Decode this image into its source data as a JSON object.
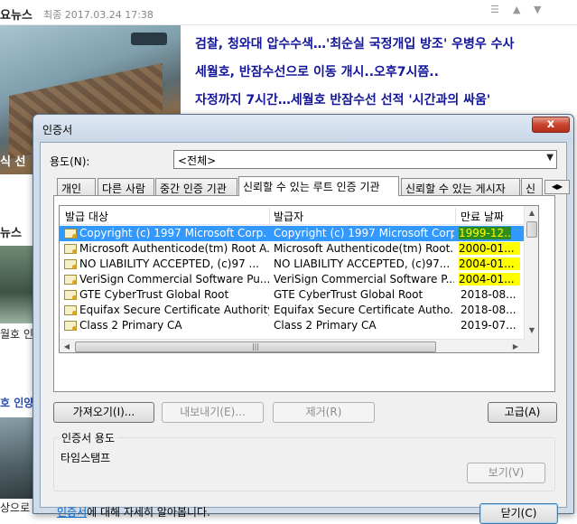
{
  "news": {
    "source": "요뉴스",
    "date": "최종 2017.03.24 17:38",
    "headlines": [
      "검찰, 청와대 압수수색…'최순실 국정개입 방조' 우병우 수사",
      "세월호, 반잠수선으로 이동 개시..오후7시쯤..",
      "자정까지 7시간…세월호 반잠수선 선적 '시간과의 싸움'"
    ],
    "left_snippets": [
      "식 선",
      "뉴스",
      "월호 인",
      "호 인양",
      "상으로"
    ]
  },
  "dialog": {
    "title": "인증서",
    "close_label": "x",
    "purpose_label": "용도(N):",
    "purpose_value": "<전체>",
    "tabs": [
      "개인",
      "다른 사람",
      "중간 인증 기관",
      "신뢰할 수 있는 루트 인증 기관",
      "신뢰할 수 있는 게시자",
      "신"
    ],
    "active_tab": "신뢰할 수 있는 루트 인증 기관",
    "columns": [
      "발급 대상",
      "발급자",
      "만료 날짜"
    ],
    "rows": [
      {
        "issued_to": "Copyright (c) 1997 Microsoft Corp.",
        "issued_by": "Copyright (c) 1997 Microsoft Corp.",
        "expiry": "1999-12...",
        "selected": true,
        "highlight": "green"
      },
      {
        "issued_to": "Microsoft Authenticode(tm) Root A...",
        "issued_by": "Microsoft Authenticode(tm) Root...",
        "expiry": "2000-01...",
        "selected": false,
        "highlight": "yellow"
      },
      {
        "issued_to": "NO LIABILITY ACCEPTED, (c)97 ...",
        "issued_by": "NO LIABILITY ACCEPTED, (c)97...",
        "expiry": "2004-01...",
        "selected": false,
        "highlight": "yellow"
      },
      {
        "issued_to": "VeriSign Commercial Software Pu...",
        "issued_by": "VeriSign Commercial Software P...",
        "expiry": "2004-01...",
        "selected": false,
        "highlight": "yellow"
      },
      {
        "issued_to": "GTE CyberTrust Global Root",
        "issued_by": "GTE CyberTrust Global Root",
        "expiry": "2018-08...",
        "selected": false,
        "highlight": ""
      },
      {
        "issued_to": "Equifax Secure Certificate Authority",
        "issued_by": "Equifax Secure Certificate Autho...",
        "expiry": "2018-08...",
        "selected": false,
        "highlight": ""
      },
      {
        "issued_to": "Class 2 Primary CA",
        "issued_by": "Class 2 Primary CA",
        "expiry": "2019-07...",
        "selected": false,
        "highlight": ""
      }
    ],
    "buttons": {
      "import": "가져오기(I)...",
      "export": "내보내기(E)...",
      "remove": "제거(R)",
      "advanced": "고급(A)",
      "view": "보기(V)",
      "close": "닫기(C)"
    },
    "group_label": "인증서 용도",
    "group_value": "타임스탬프",
    "learn_link": "인증서",
    "learn_text": "에 대해 자세히 알아봅니다."
  }
}
